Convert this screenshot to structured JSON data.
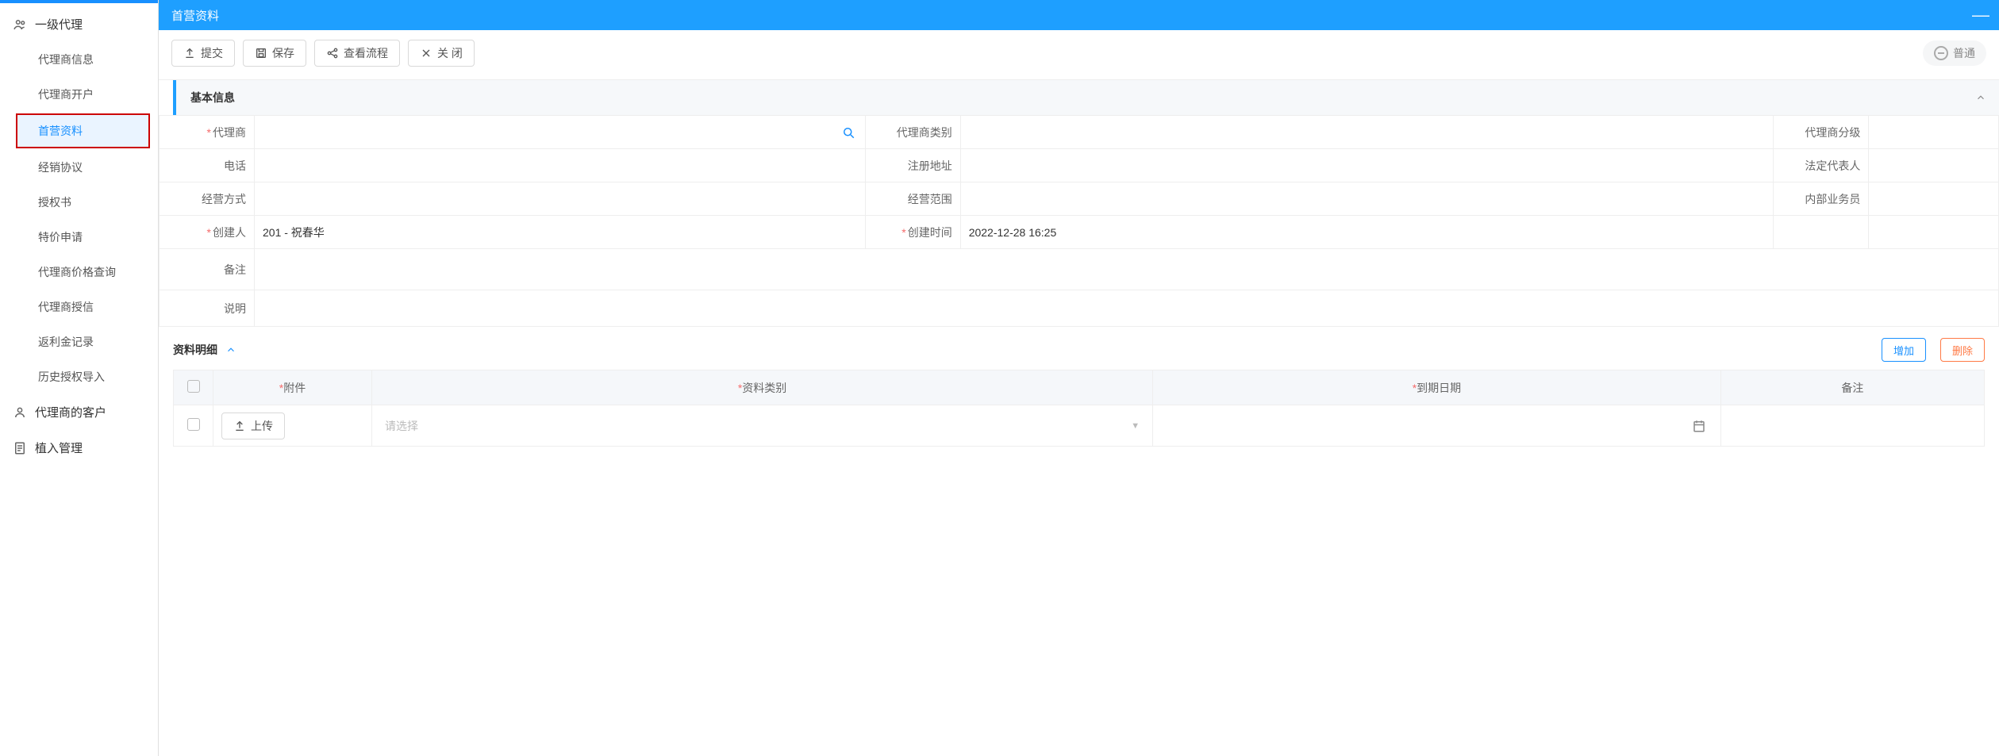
{
  "titlebar": {
    "title": "首营资料"
  },
  "toolbar": {
    "submit": "提交",
    "save": "保存",
    "viewflow": "查看流程",
    "close": "关 闭"
  },
  "normal_chip": "普通",
  "sidebar": {
    "groups": [
      {
        "title": "一级代理",
        "icon": "users",
        "items": [
          "代理商信息",
          "代理商开户",
          "首营资料",
          "经销协议",
          "授权书",
          "特价申请",
          "代理商价格查询",
          "代理商授信",
          "返利金记录",
          "历史授权导入"
        ],
        "activeIndex": 2
      },
      {
        "title": "代理商的客户",
        "icon": "user",
        "items": []
      },
      {
        "title": "植入管理",
        "icon": "doc",
        "items": []
      }
    ]
  },
  "section": {
    "basic": "基本信息"
  },
  "form": {
    "agent_label": "代理商",
    "agent_type_label": "代理商类别",
    "agent_level_label": "代理商分级",
    "phone_label": "电话",
    "reg_addr_label": "注册地址",
    "legal_rep_label": "法定代表人",
    "biz_mode_label": "经营方式",
    "biz_scope_label": "经营范围",
    "internal_sales_label": "内部业务员",
    "creator_label": "创建人",
    "creator_value": "201 - 祝春华",
    "create_time_label": "创建时间",
    "create_time_value": "2022-12-28 16:25",
    "remark_label": "备注",
    "desc_label": "说明"
  },
  "detail": {
    "title": "资料明细",
    "add": "增加",
    "del": "删除",
    "columns": {
      "attachment": "附件",
      "type": "资料类别",
      "expire": "到期日期",
      "remark": "备注"
    },
    "upload": "上传",
    "select_ph": "请选择"
  }
}
